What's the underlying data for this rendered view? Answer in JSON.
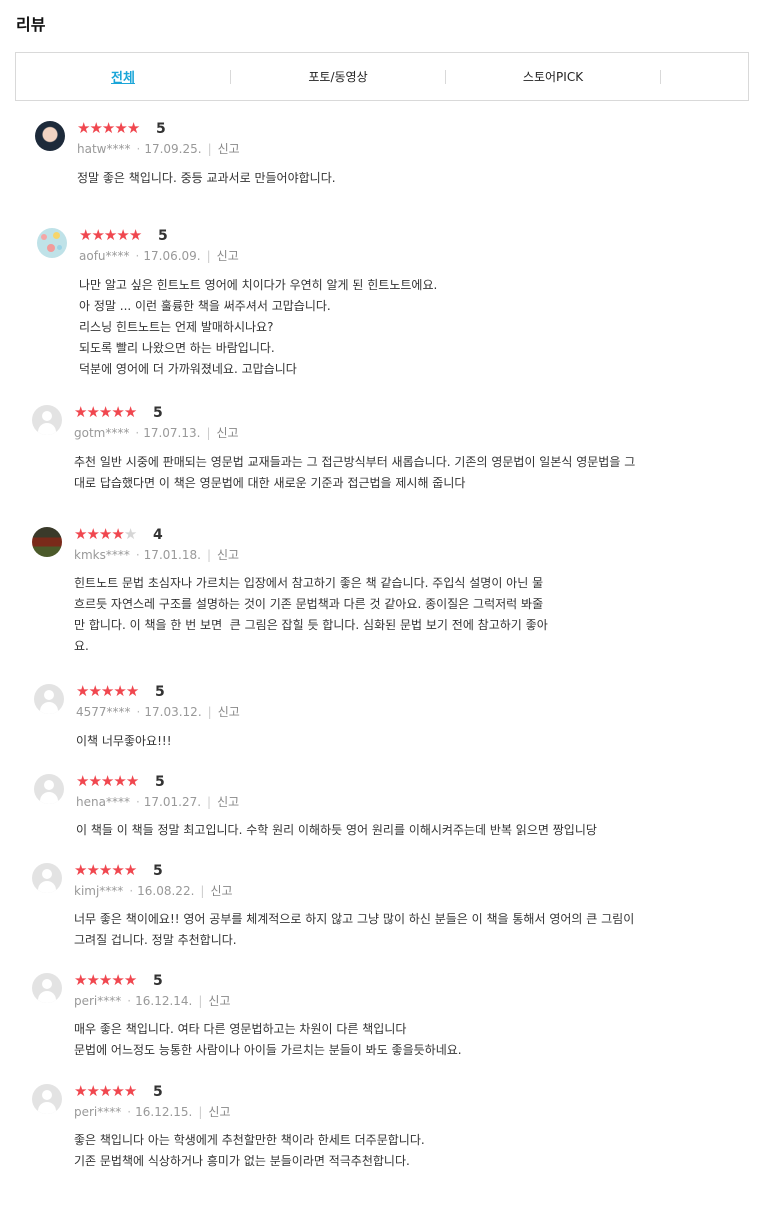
{
  "section_title": "리뷰",
  "tabs": [
    {
      "label": "전체"
    },
    {
      "label": "포토/동영상"
    },
    {
      "label": "스토어PICK"
    }
  ],
  "report_label": "신고",
  "reviews": [
    {
      "user": "hatw****",
      "date": "17.09.25.",
      "score": "5",
      "stars": 5,
      "text": "정말 좋은 책입니다. 중등 교과서로 만들어야합니다."
    },
    {
      "user": "aofu****",
      "date": "17.06.09.",
      "score": "5",
      "stars": 5,
      "text": "나만 알고 싶은 힌트노트 영어에 치이다가 우연히 알게 된 힌트노트에요.\n아 정말 ... 이런 훌륭한 책을 써주셔서 고맙습니다.\n리스닝 힌트노트는 언제 발매하시나요?\n되도록 빨리 나왔으면 하는 바람입니다.\n덕분에 영어에 더 가까워졌네요. 고맙습니다"
    },
    {
      "user": "gotm****",
      "date": "17.07.13.",
      "score": "5",
      "stars": 5,
      "text": "추천 일반 시중에 판매되는 영문법 교재들과는 그 접근방식부터 새롭습니다. 기존의 영문법이 일본식 영문법을 그\n대로 답습했다면 이 책은 영문법에 대한 새로운 기준과 접근법을 제시해 줍니다"
    },
    {
      "user": "kmks****",
      "date": "17.01.18.",
      "score": "4",
      "stars": 4,
      "text": "힌트노트 문법 초심자나 가르치는 입장에서 참고하기 좋은 책 같습니다. 주입식 설명이 아닌 물\n흐르듯 자연스레 구조를 설명하는 것이 기존 문법책과 다른 것 같아요. 종이질은 그럭저럭 봐줄\n만 합니다. 이 책을 한 번 보면  큰 그림은 잡힐 듯 합니다. 심화된 문법 보기 전에 참고하기 좋아\n요."
    },
    {
      "user": "4577****",
      "date": "17.03.12.",
      "score": "5",
      "stars": 5,
      "text": "이책 너무좋아요!!!"
    },
    {
      "user": "hena****",
      "date": "17.01.27.",
      "score": "5",
      "stars": 5,
      "text": "이 책들 이 책들 정말 최고입니다. 수학 원리 이해하듯 영어 원리를 이해시켜주는데 반복 읽으면 짱입니당"
    },
    {
      "user": "kimj****",
      "date": "16.08.22.",
      "score": "5",
      "stars": 5,
      "text": "너무 좋은 책이에요!! 영어 공부를 체계적으로 하지 않고 그냥 많이 하신 분들은 이 책을 통해서 영어의 큰 그림이\n그려질 겁니다. 정말 추천합니다."
    },
    {
      "user": "peri****",
      "date": "16.12.14.",
      "score": "5",
      "stars": 5,
      "text": "매우 좋은 책입니다. 여타 다른 영문법하고는 차원이 다른 책입니다\n문법에 어느정도 능통한 사람이나 아이들 가르치는 분들이 봐도 좋을듯하네요."
    },
    {
      "user": "peri****",
      "date": "16.12.15.",
      "score": "5",
      "stars": 5,
      "text": "좋은 책입니다 아는 학생에게 추천할만한 책이라 한세트 더주문합니다.\n기존 문법책에 식상하거나 흥미가 없는 분들이라면 적극추천합니다."
    }
  ],
  "colors": {
    "star_on": "#f0474f",
    "star_off": "#d6d6d6",
    "tab_active": "#1aa5d8"
  },
  "icons": {
    "avatar_default": "user-silhouette-icon",
    "star": "star-icon"
  }
}
